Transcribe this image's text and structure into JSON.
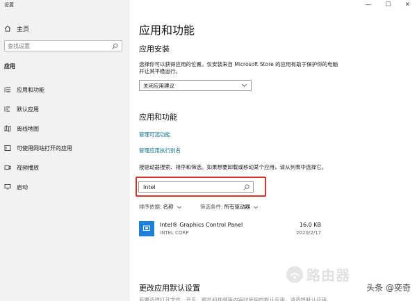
{
  "window": {
    "title": "设置"
  },
  "titlebar": {
    "minimize": "—",
    "maximize": "☐",
    "close": "✕"
  },
  "sidebar": {
    "home_label": "主页",
    "search_placeholder": "查找设置",
    "section_title": "应用",
    "items": [
      {
        "label": "应用和功能",
        "icon": "apps-list-icon"
      },
      {
        "label": "默认应用",
        "icon": "default-apps-icon"
      },
      {
        "label": "离线地图",
        "icon": "offline-maps-icon"
      },
      {
        "label": "可使用网站打开的应用",
        "icon": "website-apps-icon"
      },
      {
        "label": "视频播放",
        "icon": "video-playback-icon"
      },
      {
        "label": "启动",
        "icon": "startup-icon"
      }
    ]
  },
  "main": {
    "title": "应用和功能",
    "install": {
      "heading": "应用安装",
      "description": "选择你可以获得应用的位置。仅安装来自 Microsoft Store 的应用有助于保护你的电脑并让其平稳运行。",
      "dropdown_value": "关闭应用建议"
    },
    "apps": {
      "heading": "应用和功能",
      "link_optional": "管理可选功能",
      "link_alias": "管理应用执行别名",
      "description": "按驱动器搜索、排序和筛选。如果想要卸载或移动某个应用，请从列表中选择它。",
      "search_value": "Intel",
      "sort_label": "排序依据:",
      "sort_value": "名称",
      "filter_label": "筛选条件:",
      "filter_value": "所有驱动器",
      "list": [
        {
          "name": "Intel® Graphics Control Panel",
          "publisher": "INTEL CORP",
          "size": "16.0 KB",
          "date": "2020/2/17"
        }
      ]
    },
    "defaults": {
      "heading": "更改应用默认设置",
      "description": "若要选择打开文件、音乐、照片和视频等内容时使用的默认应用，请选择默认应用。"
    }
  },
  "overlay": {
    "watermark": "路由器",
    "brand": "头条 @奕奇"
  },
  "colors": {
    "accent": "#0a6e8a",
    "highlight": "#d6322e",
    "app_tile": "#1e7fd6",
    "sidebar_bg": "#f2f2f2"
  }
}
